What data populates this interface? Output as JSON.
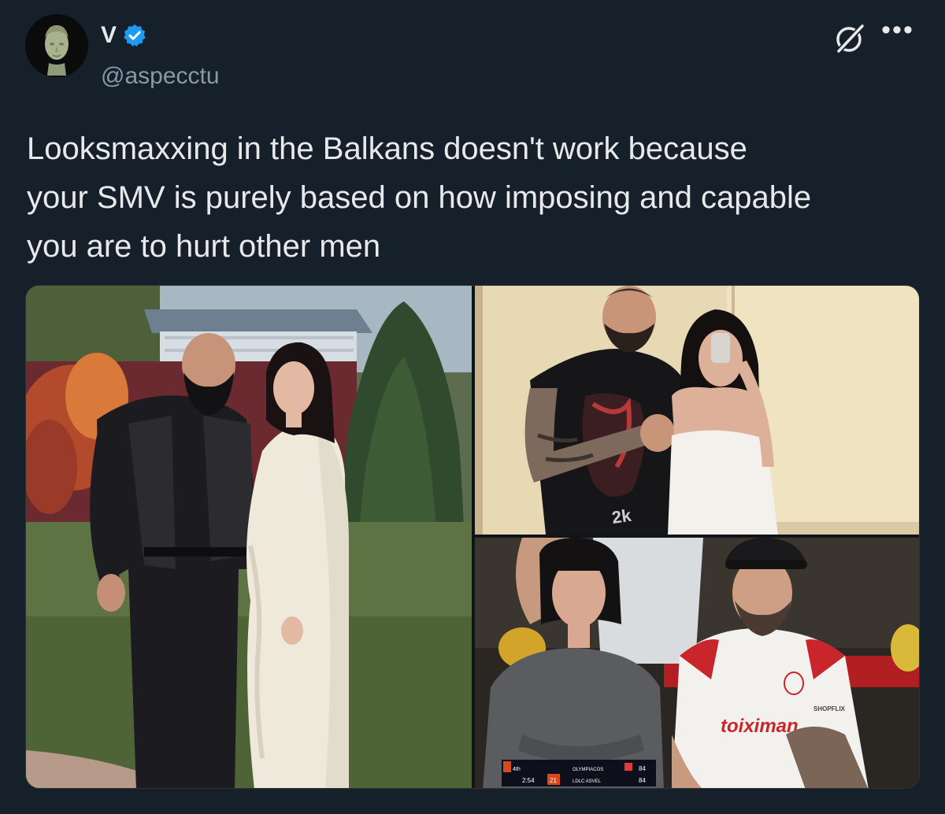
{
  "user": {
    "display_name": "V",
    "handle": "@aspecctu",
    "verified": true
  },
  "tweet": {
    "text": "Looksmaxxing in the Balkans doesn't work because\nyour SMV is purely based on how imposing and capable\nyou are to hurt other men"
  },
  "icons": {
    "verified": "verified-badge-icon",
    "grok": "grok-icon",
    "more": "more-options-icon"
  },
  "media": {
    "photos": [
      {
        "alt": "Bearded man in black vest standing beside woman in long white dress in a garden"
      },
      {
        "alt": "Tattooed bearded man in black t-shirt beside woman in white dress taking a mirror selfie"
      },
      {
        "alt": "Woman with bob haircut and bearded man in red-white jersey seated at a basketball game"
      }
    ],
    "scorebug": {
      "home": "OLYMPIACOS",
      "away": "LDLC ASVEL",
      "home_score": "84",
      "away_score": "84",
      "quarter": "4th",
      "clock": "2:54",
      "shot_clock": "21"
    },
    "jersey_text": "toiximan",
    "sponsor_text": "SHOPFLIX"
  },
  "colors": {
    "background": "#15202b",
    "text": "#e7e9ea",
    "secondary_text": "#8b98a5",
    "verified_blue": "#1d9bf0"
  }
}
